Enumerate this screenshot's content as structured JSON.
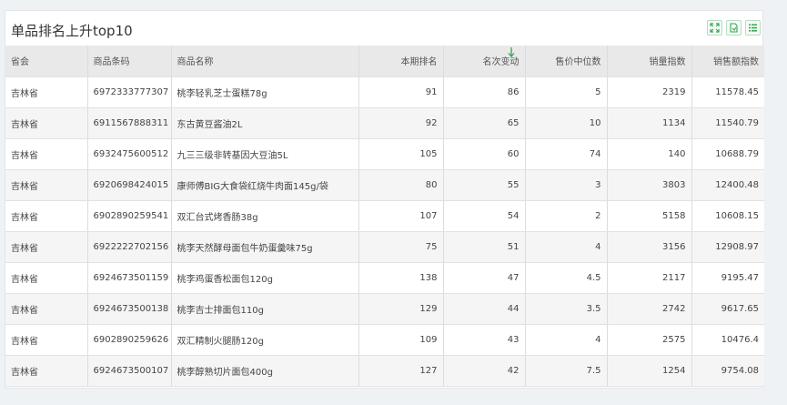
{
  "panel": {
    "title": "单品排名上升top10",
    "tools": [
      {
        "icon": "fullscreen-icon"
      },
      {
        "icon": "export-icon"
      },
      {
        "icon": "list-icon"
      }
    ],
    "accent_color": "#2fa84f"
  },
  "table": {
    "columns": [
      "省会",
      "商品条码",
      "商品名称",
      "本期排名",
      "名次变动",
      "售价中位数",
      "销量指数",
      "销售额指数"
    ],
    "sorted_column": "名次变动",
    "sort_direction": "desc",
    "rows": [
      [
        "吉林省",
        "6972333777307",
        "桃李轻乳芝士蛋糕78g",
        "91",
        "86",
        "5",
        "2319",
        "11578.45"
      ],
      [
        "吉林省",
        "6911567888311",
        "东古黄豆酱油2L",
        "92",
        "65",
        "10",
        "1134",
        "11540.79"
      ],
      [
        "吉林省",
        "6932475600512",
        "九三三级非转基因大豆油5L",
        "105",
        "60",
        "74",
        "140",
        "10688.79"
      ],
      [
        "吉林省",
        "6920698424015",
        "康师傅BIG大食袋红烧牛肉面145g/袋",
        "80",
        "55",
        "3",
        "3803",
        "12400.48"
      ],
      [
        "吉林省",
        "6902890259541",
        "双汇台式烤香肠38g",
        "107",
        "54",
        "2",
        "5158",
        "10608.15"
      ],
      [
        "吉林省",
        "6922222702156",
        "桃李天然酵母面包牛奶蛋羹味75g",
        "75",
        "51",
        "4",
        "3156",
        "12908.97"
      ],
      [
        "吉林省",
        "6924673501159",
        "桃李鸡蛋香松面包120g",
        "138",
        "47",
        "4.5",
        "2117",
        "9195.47"
      ],
      [
        "吉林省",
        "6924673500138",
        "桃李吉士排面包110g",
        "129",
        "44",
        "3.5",
        "2742",
        "9617.65"
      ],
      [
        "吉林省",
        "6902890259626",
        "双汇精制火腿肠120g",
        "109",
        "43",
        "4",
        "2575",
        "10476.4"
      ],
      [
        "吉林省",
        "6924673500107",
        "桃李醇熟切片面包400g",
        "127",
        "42",
        "7.5",
        "1254",
        "9754.08"
      ]
    ]
  }
}
